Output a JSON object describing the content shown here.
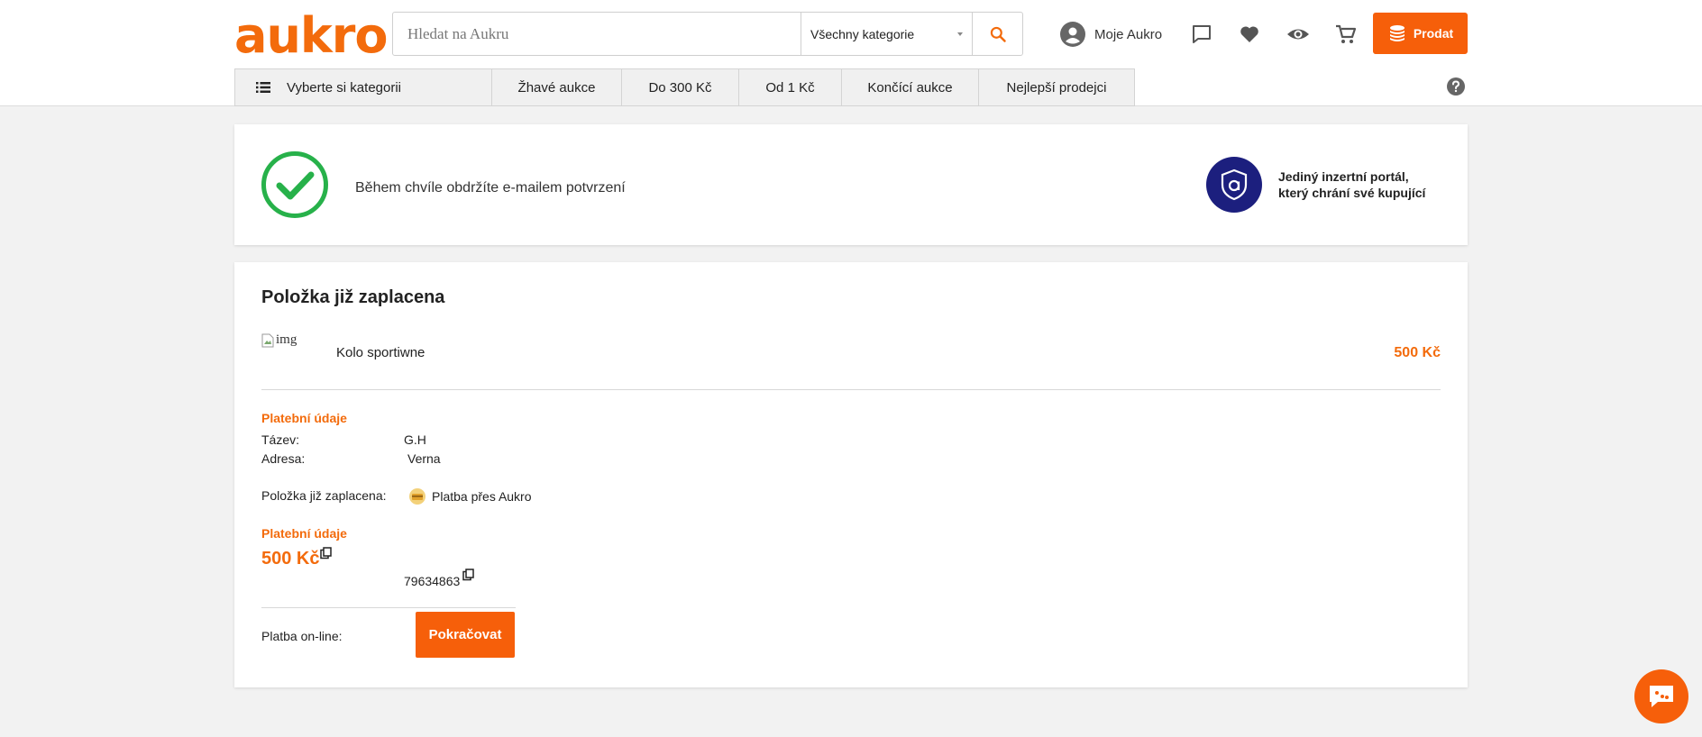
{
  "header": {
    "logo": "aukro",
    "search_placeholder": "Hledat na Aukru",
    "category_select": "Všechny kategorie",
    "account_label": "Moje Aukro",
    "sell_label": "Prodat"
  },
  "nav": {
    "items": [
      {
        "label": "Vyberte si kategorii"
      },
      {
        "label": "Žhavé aukce"
      },
      {
        "label": "Do 300 Kč"
      },
      {
        "label": "Od 1 Kč"
      },
      {
        "label": "Končící aukce"
      },
      {
        "label": "Nejlepší prodejci"
      }
    ]
  },
  "confirmation": {
    "message": "Během chvíle obdržíte e-mailem potvrzení",
    "guarantee_line1": "Jediný inzertní portál,",
    "guarantee_line2": "který chrání své kupující"
  },
  "order": {
    "title": "Položka již zaplacena",
    "image_alt": "img",
    "item_name": "Kolo sportiwne",
    "item_price": "500 Kč",
    "payment_section_label": "Platební údaje",
    "name_label": "Tázev:",
    "name_value": "G.H",
    "address_label": "Adresa:",
    "address_value": "Verna",
    "paid_label": "Položka již zaplacena:",
    "paid_value": "Platba přes Aukro",
    "payment_section_label_2": "Platební údaje",
    "amount": "500 Kč",
    "account_number": "79634863",
    "online_label": "Platba on-line:",
    "continue_label": "Pokračovat"
  },
  "colors": {
    "brand": "#f36b0c",
    "button": "#f65f0a",
    "success": "#27b14a",
    "shield": "#1c1f7e"
  }
}
